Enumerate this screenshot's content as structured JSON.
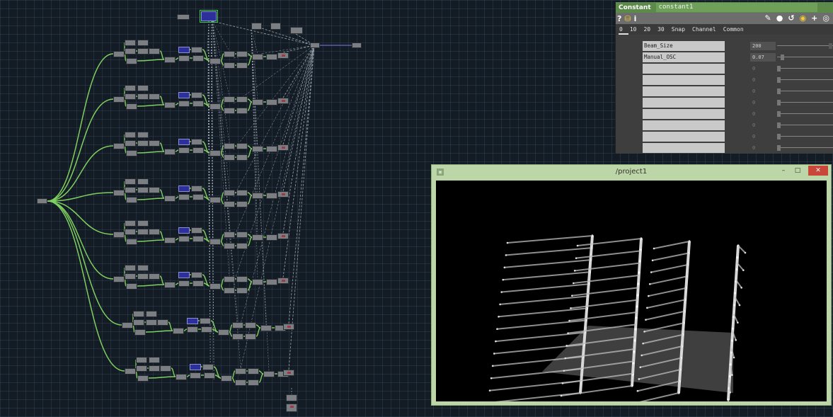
{
  "window": {
    "viewer_title": "/project1",
    "minimize_glyph": "–",
    "maximize_glyph": "□",
    "close_glyph": "✕"
  },
  "param_panel": {
    "op_type": "Constant",
    "op_name": "constant1",
    "toolbar_left": [
      "?",
      "i"
    ],
    "tabs": [
      "0",
      "10",
      "20",
      "30",
      "Snap",
      "Channel",
      "Common"
    ],
    "rows": [
      {
        "name": "Beam_Size",
        "value": "200",
        "knob": 1.0
      },
      {
        "name": "Manual_OSC",
        "value": "0.07",
        "knob": 0.07
      },
      {
        "name": "",
        "value": "0"
      },
      {
        "name": "",
        "value": "0"
      },
      {
        "name": "",
        "value": "0"
      },
      {
        "name": "",
        "value": "0"
      },
      {
        "name": "",
        "value": "0"
      },
      {
        "name": "",
        "value": "0"
      },
      {
        "name": "",
        "value": "0"
      },
      {
        "name": "",
        "value": "0"
      }
    ]
  },
  "colors": {
    "accent_green": "#5b8a4a",
    "wire_green": "#7fcf5f",
    "wire_gray": "#9aa3ab",
    "viewer_frame": "#bcd6a7",
    "close_red": "#c9463b"
  },
  "icons": {
    "help": "question-icon",
    "python": "python-icon",
    "info": "info-icon",
    "edit": "pencil-icon",
    "comment": "comment-icon",
    "clone": "clone-icon",
    "add": "plus-icon",
    "target": "target-icon"
  }
}
